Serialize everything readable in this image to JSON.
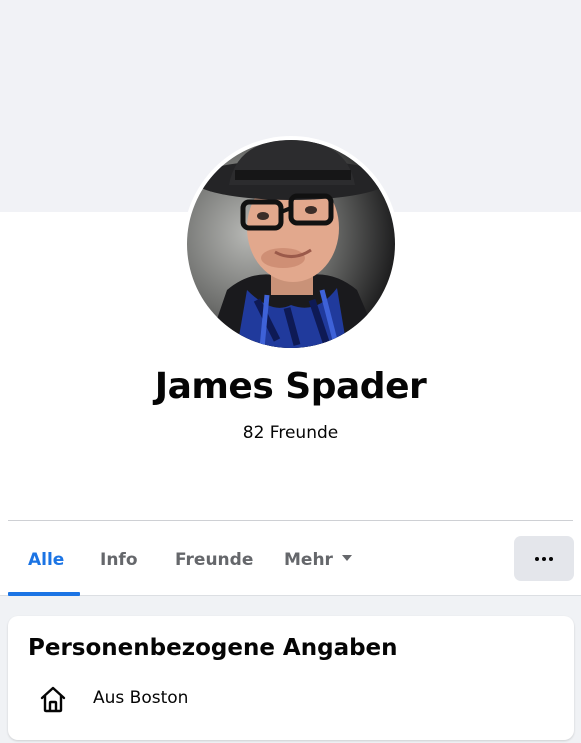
{
  "profile": {
    "name": "James Spader",
    "friends_count": "82 Freunde"
  },
  "tabs": [
    {
      "label": "Alle",
      "active": true
    },
    {
      "label": "Info",
      "active": false
    },
    {
      "label": "Freunde",
      "active": false
    },
    {
      "label": "Mehr",
      "active": false
    }
  ],
  "more_button": {
    "icon": "more-dots-icon"
  },
  "about": {
    "title": "Personenbezogene Angaben",
    "items": [
      {
        "icon": "home-icon",
        "text": "Aus Boston"
      }
    ]
  },
  "colors": {
    "accent": "#1b74e4",
    "background": "#f0f2f5",
    "text": "#050505",
    "muted": "#65676b"
  }
}
